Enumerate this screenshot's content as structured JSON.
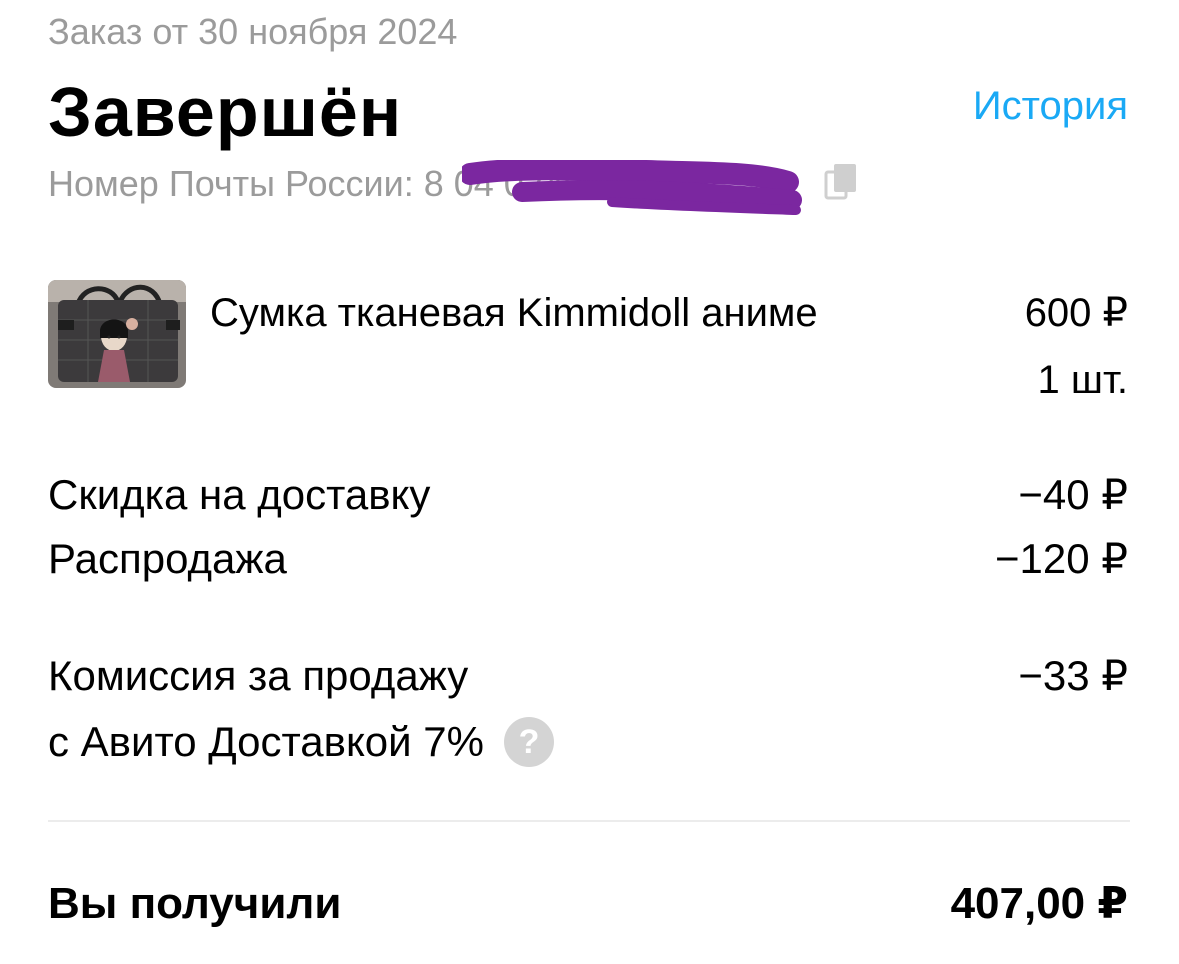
{
  "header": {
    "order_date": "Заказ от 30 ноября 2024",
    "status": "Завершён",
    "history_label": "История",
    "history_color": "#1aa9f5"
  },
  "tracking": {
    "label": "Номер Почты России:",
    "number_visible": "8                     04 02407",
    "redacted": true,
    "redaction_color": "#7b27a0",
    "copy_icon": "copy-icon"
  },
  "item": {
    "title": "Сумка тканевая Kimmidoll аниме",
    "price": "600 ₽",
    "quantity": "1 шт.",
    "image_icon": "product-photo"
  },
  "adjustments": [
    {
      "label": "Скидка на доставку",
      "value": "−40 ₽"
    },
    {
      "label": "Распродажа",
      "value": "−120 ₽"
    }
  ],
  "commission": {
    "label_line1": "Комиссия за продажу",
    "label_line2": "с Авито Доставкой 7%",
    "value": "−33 ₽",
    "help_symbol": "?",
    "help_icon": "question-icon"
  },
  "total": {
    "label": "Вы получили",
    "value": "407,00 ₽"
  }
}
